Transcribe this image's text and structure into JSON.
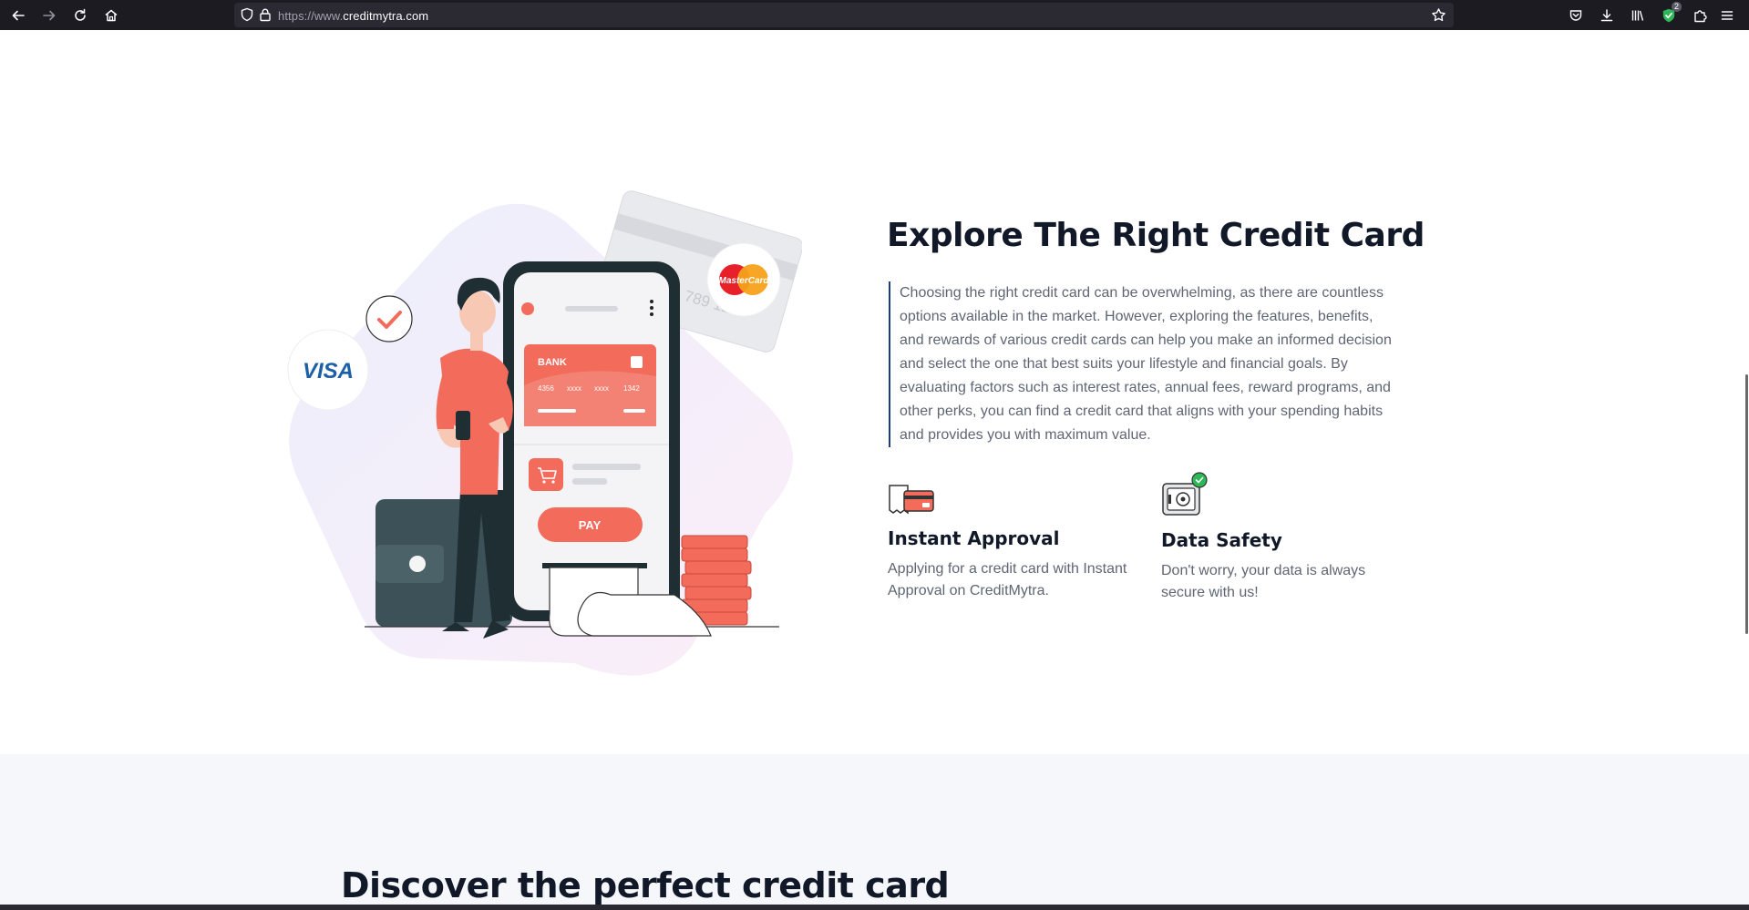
{
  "browser": {
    "url_prefix": "https://www.",
    "url_domain": "creditmytra.com",
    "extension_badge": "2",
    "icons": [
      "back-icon",
      "forward-icon",
      "reload-icon",
      "home-icon",
      "shield-icon",
      "lock-icon",
      "bookmark-star-icon",
      "pocket-icon",
      "download-icon",
      "library-icon",
      "extension-shield-icon",
      "puzzle-icon",
      "menu-icon"
    ]
  },
  "hero": {
    "title": "Explore The Right Credit Card",
    "description": "Choosing the right credit card can be overwhelming, as there are countless options available in the market. However, exploring the features, benefits, and rewards of various credit cards can help you make an informed decision and select the one that best suits your lifestyle and financial goals. By evaluating factors such as interest rates, annual fees, reward programs, and other perks, you can find a credit card that aligns with your spending habits and provides you with maximum value.",
    "illustration": {
      "visa_label": "VISA",
      "mastercard_label": "MasterCard",
      "card_bank": "BANK",
      "card_number_1": "4356",
      "card_number_2": "xxxx",
      "card_number_3": "xxxx",
      "card_number_4": "1342",
      "back_card_digits": "789 123",
      "pay_button": "PAY"
    },
    "features": [
      {
        "title": "Instant Approval",
        "text": "Applying for a credit card with Instant Approval on CreditMytra.",
        "icon": "credit-card-receipt-icon"
      },
      {
        "title": "Data Safety",
        "text": "Don't worry, your data is always secure with us!",
        "icon": "safe-vault-icon"
      }
    ]
  },
  "discover": {
    "title": "Discover the perfect credit card"
  },
  "colors": {
    "accent": "#f26b5b",
    "heading": "#111827",
    "body_text": "#5f6673",
    "quote_border": "#1e3a8a",
    "browser_chrome": "#1c1b22"
  }
}
